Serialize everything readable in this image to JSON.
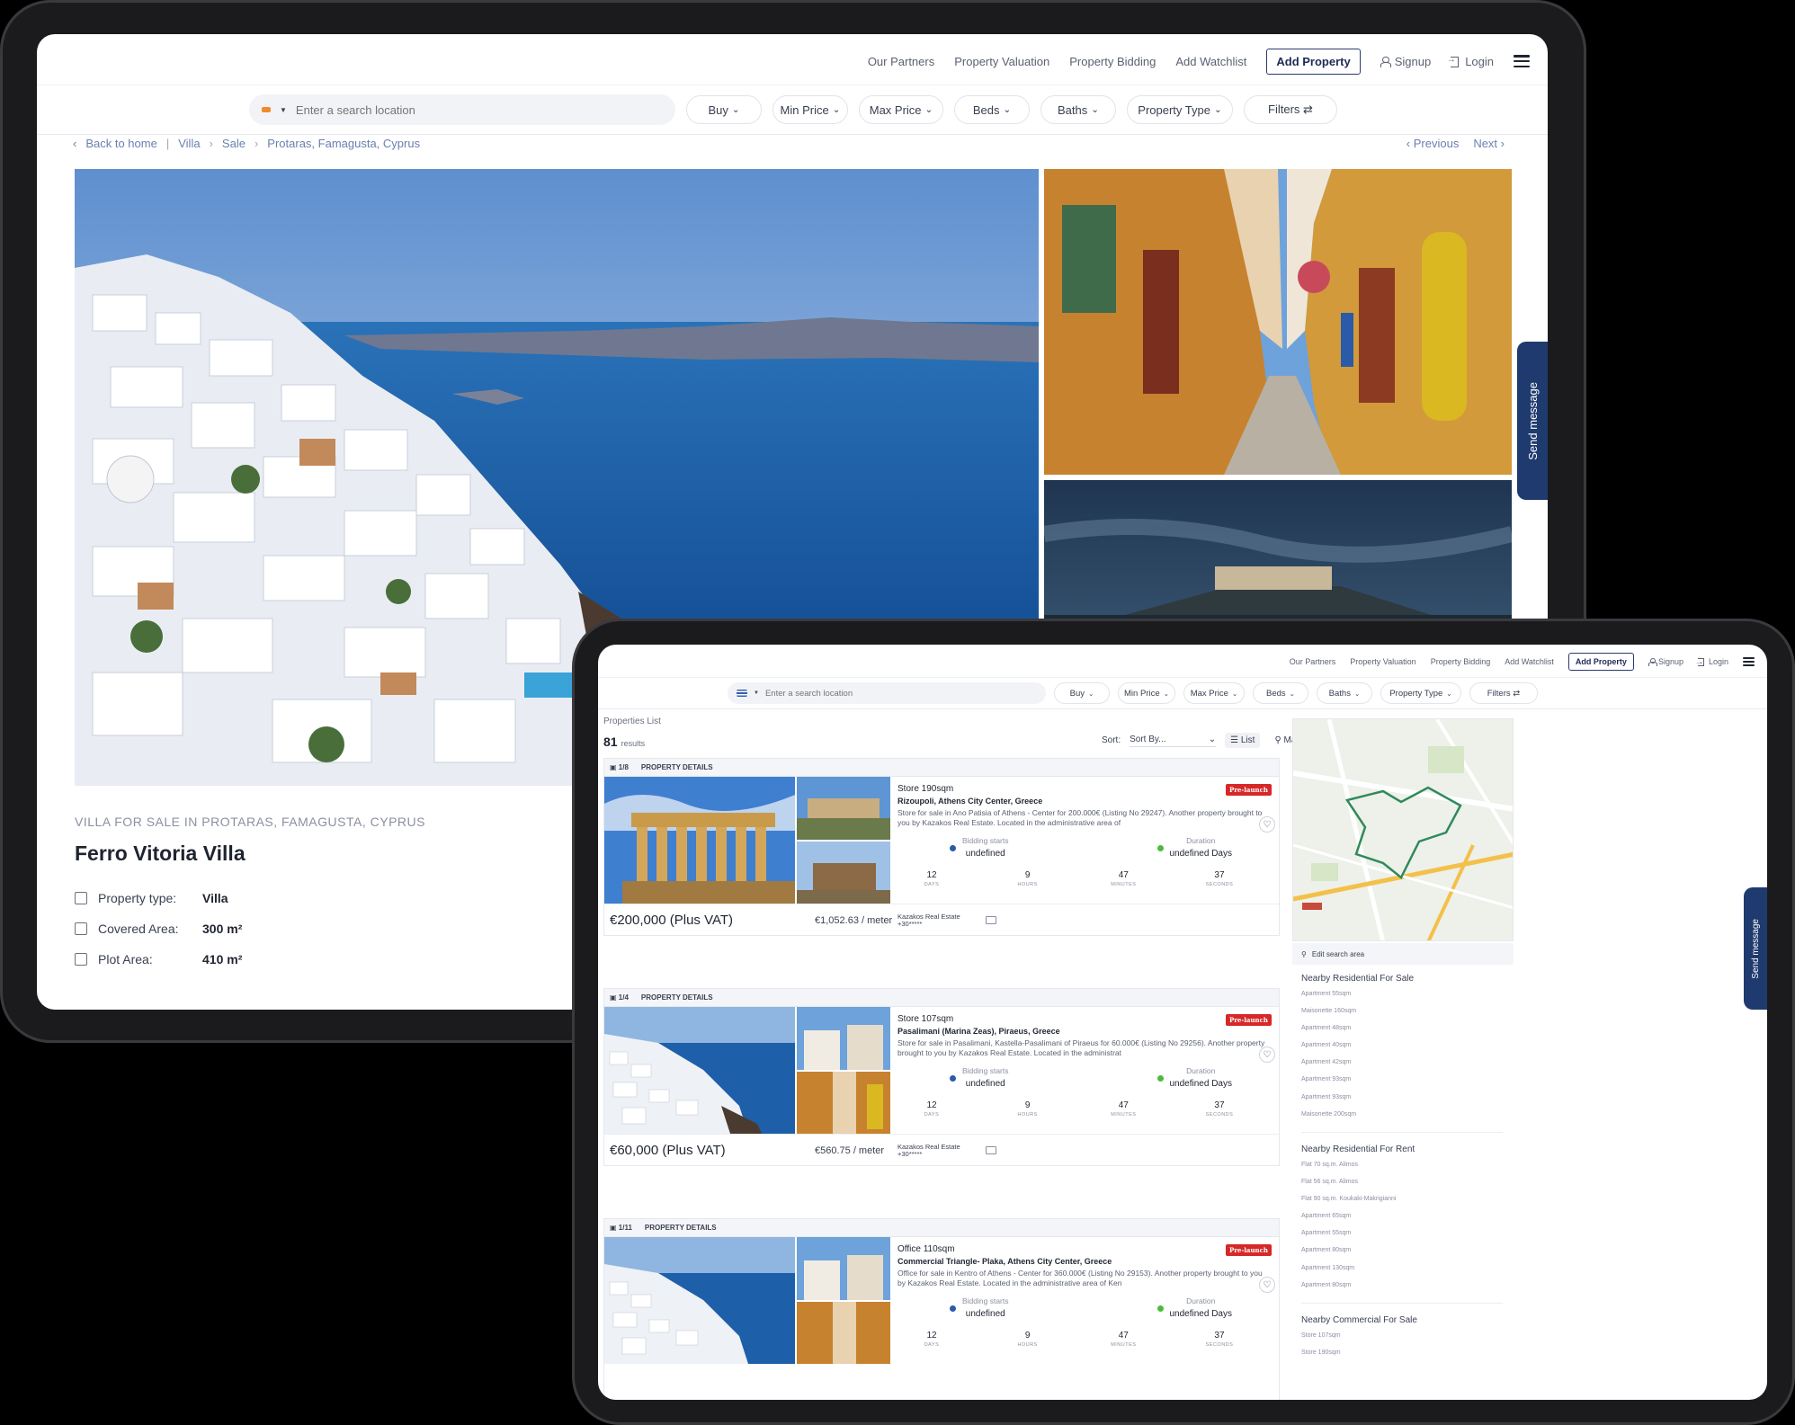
{
  "nav": {
    "links": [
      "Our Partners",
      "Property Valuation",
      "Property Bidding",
      "Add Watchlist"
    ],
    "add_property": "Add Property",
    "signup": "Signup",
    "login": "Login"
  },
  "search": {
    "placeholder": "Enter a search location",
    "filters": [
      "Buy",
      "Min Price",
      "Max Price",
      "Beds",
      "Baths",
      "Property Type"
    ],
    "filters_button": "Filters ⇄"
  },
  "detail": {
    "breadcrumbs": [
      "Back to home",
      "Villa",
      "Sale",
      "Protaras, Famagusta, Cyprus"
    ],
    "previous": "Previous",
    "next": "Next",
    "subtitle": "VILLA FOR SALE IN PROTARAS, FAMAGUSTA, CYPRUS",
    "title": "Ferro Vitoria Villa",
    "facts": [
      {
        "label": "Property type:",
        "value": "Villa"
      },
      {
        "label": "Covered Area:",
        "value": "300 m²"
      },
      {
        "label": "Plot Area:",
        "value": "410 m²"
      }
    ],
    "send_message": "Send message"
  },
  "listing": {
    "section_label": "Properties List",
    "result_count": "81",
    "results_word": "results",
    "sort_label": "Sort:",
    "sort_value": "Sort By...",
    "view_list": "List",
    "view_map": "Map",
    "cards": [
      {
        "photo_count": "1/8",
        "head_label": "PROPERTY DETAILS",
        "title": "Store 190sqm",
        "address": "Rizoupoli, Athens City Center, Greece",
        "description": "Store for sale in Ano Patisia of Athens - Center for 200.000€ (Listing No 29247). Another property brought to you by Kazakos Real Estate. Located in the administrative area of",
        "badge": "Pre-launch",
        "bidding_label": "Bidding starts",
        "bidding_value": "undefined",
        "duration_label": "Duration",
        "duration_value": "undefined Days",
        "countdown": [
          {
            "n": "12",
            "u": "DAYS"
          },
          {
            "n": "9",
            "u": "HOURS"
          },
          {
            "n": "47",
            "u": "MINUTES"
          },
          {
            "n": "37",
            "u": "SECONDS"
          }
        ],
        "price": "€200,000 (Plus VAT)",
        "per_meter": "€1,052.63 / meter",
        "agent": "Kazakos Real Estate",
        "phone": "+30*****"
      },
      {
        "photo_count": "1/4",
        "head_label": "PROPERTY DETAILS",
        "title": "Store 107sqm",
        "address": "Pasalimani (Marina Zeas), Piraeus, Greece",
        "description": "Store for sale in Pasalimani, Kastella-Pasalimani of Piraeus for 60.000€ (Listing No 29256). Another property brought to you by Kazakos Real Estate. Located in the administrat",
        "badge": "Pre-launch",
        "bidding_label": "Bidding starts",
        "bidding_value": "undefined",
        "duration_label": "Duration",
        "duration_value": "undefined Days",
        "countdown": [
          {
            "n": "12",
            "u": "DAYS"
          },
          {
            "n": "9",
            "u": "HOURS"
          },
          {
            "n": "47",
            "u": "MINUTES"
          },
          {
            "n": "37",
            "u": "SECONDS"
          }
        ],
        "price": "€60,000 (Plus VAT)",
        "per_meter": "€560.75 / meter",
        "agent": "Kazakos Real Estate",
        "phone": "+30*****"
      },
      {
        "photo_count": "1/11",
        "head_label": "PROPERTY DETAILS",
        "title": "Office 110sqm",
        "address": "Commercial Triangle- Plaka, Athens City Center, Greece",
        "description": "Office for sale in Kentro of Athens - Center for 360.000€ (Listing No 29153). Another property brought to you by Kazakos Real Estate. Located in the administrative area of Ken",
        "badge": "Pre-launch",
        "bidding_label": "Bidding starts",
        "bidding_value": "undefined",
        "duration_label": "Duration",
        "duration_value": "undefined Days",
        "countdown": [
          {
            "n": "12",
            "u": "DAYS"
          },
          {
            "n": "9",
            "u": "HOURS"
          },
          {
            "n": "47",
            "u": "MINUTES"
          },
          {
            "n": "37",
            "u": "SECONDS"
          }
        ]
      }
    ],
    "edit_search_area": "Edit search area",
    "nearby": [
      {
        "title": "Nearby Residential For Sale",
        "items": [
          "Apartment 55sqm",
          "Maisonette 160sqm",
          "Apartment 48sqm",
          "Apartment 40sqm",
          "Apartment 42sqm",
          "Apartment 93sqm",
          "Apartment 93sqm",
          "Maisonette 200sqm"
        ]
      },
      {
        "title": "Nearby Residential For Rent",
        "items": [
          "Flat 70 sq.m. Alimos",
          "Flat 56 sq.m. Alimos",
          "Flat 90 sq.m. Koukaki-Makrigianni",
          "Apartment 65sqm",
          "Apartment 55sqm",
          "Apartment 80sqm",
          "Apartment 130sqm",
          "Apartment 80sqm"
        ]
      },
      {
        "title": "Nearby Commercial For Sale",
        "items": [
          "Store 107sqm",
          "Store 190sqm"
        ]
      }
    ],
    "send_message": "Send message"
  },
  "colors": {
    "accent": "#1f3a6e",
    "badge": "#d62828",
    "dot_blue": "#2b5aa8",
    "dot_green": "#4cbb3c"
  }
}
